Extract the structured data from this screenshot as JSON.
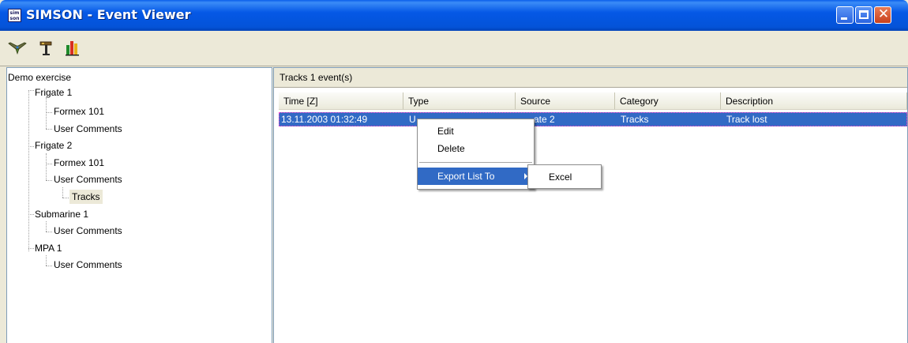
{
  "window": {
    "title": "SIMSON - Event Viewer",
    "app_icon_line1": "sim",
    "app_icon_line2": "son",
    "controls": [
      "minimize",
      "maximize",
      "close"
    ]
  },
  "toolbar": {
    "icons": [
      "plane-icon",
      "radar-tower-icon",
      "bar-graph-icon"
    ]
  },
  "tree": {
    "root": "Demo exercise",
    "nodes": [
      {
        "label": "Frigate 1",
        "children": [
          {
            "label": "Formex 101"
          },
          {
            "label": "User Comments"
          }
        ]
      },
      {
        "label": "Frigate 2",
        "children": [
          {
            "label": "Formex 101"
          },
          {
            "label": "User Comments",
            "children": [
              {
                "label": "Tracks",
                "selected": true
              }
            ]
          }
        ]
      },
      {
        "label": "Submarine 1",
        "children": [
          {
            "label": "User Comments"
          }
        ]
      },
      {
        "label": "MPA 1",
        "children": [
          {
            "label": "User Comments"
          }
        ]
      }
    ]
  },
  "events_panel": {
    "header": "Tracks 1 event(s)",
    "columns": [
      "Time [Z]",
      "Type",
      "Source",
      "Category",
      "Description"
    ],
    "rows": [
      {
        "time": "13.11.2003 01:32:49",
        "type": "U",
        "source": "ate 2",
        "category": "Tracks",
        "description": "Track lost"
      }
    ]
  },
  "context_menu": {
    "items": [
      "Edit",
      "Delete",
      "Export List To"
    ],
    "highlighted": "Export List To",
    "submenu": [
      "Excel"
    ]
  },
  "colors": {
    "title_bar": "#0558E6",
    "selection": "#316AC5",
    "face": "#ECE9D8"
  }
}
